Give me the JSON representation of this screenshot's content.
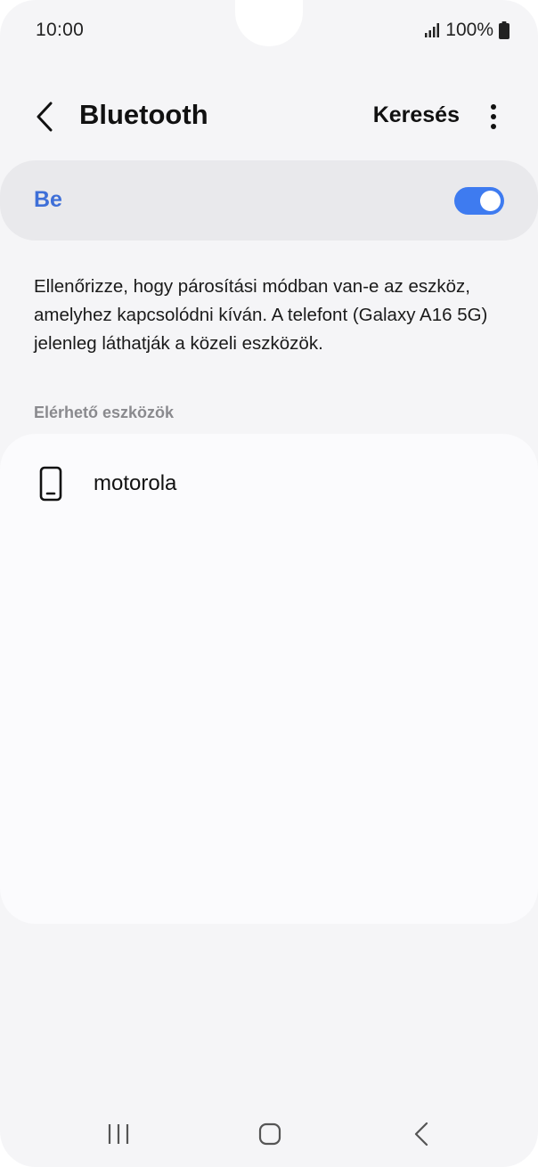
{
  "status_bar": {
    "time": "10:00",
    "battery_percent": "100%",
    "icons": [
      "signal-icon",
      "battery-icon"
    ]
  },
  "app_bar": {
    "title": "Bluetooth",
    "search_label": "Keresés",
    "icons": [
      "back-arrow-icon",
      "more-vertical-icon"
    ]
  },
  "toggle": {
    "label": "Be",
    "state": "on",
    "accent_color": "#3e7bf0",
    "label_color": "#3e6fd8"
  },
  "description": "Ellenőrizze, hogy párosítási módban van-e az eszköz, amelyhez kapcsolódni kíván. A telefont (Galaxy A16 5G) jelenleg láthatják a közeli eszközök.",
  "available_devices": {
    "header": "Elérhető eszközök",
    "items": [
      {
        "name": "motorola",
        "icon": "smartphone-icon"
      }
    ]
  },
  "nav_bar": {
    "icons": [
      "recent-apps-icon",
      "home-icon",
      "back-icon"
    ]
  }
}
